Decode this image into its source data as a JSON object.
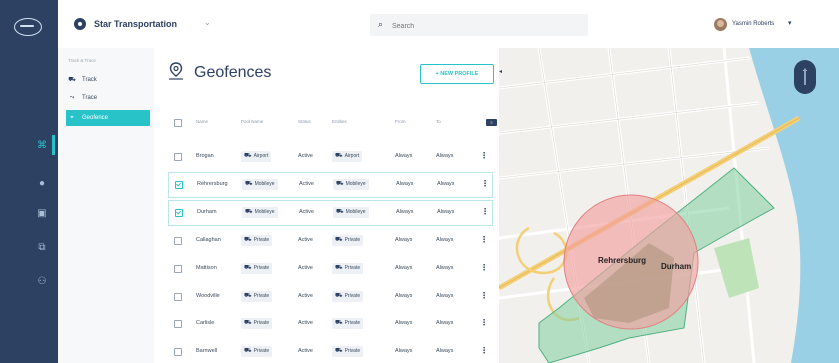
{
  "header": {
    "org_name": "Star Transportation",
    "search_placeholder": "Search",
    "user_name": "Yasmin Roberts"
  },
  "sidebar": {
    "section_label": "Track & Trace",
    "items": [
      {
        "label": "Track",
        "icon": "truck-icon",
        "active": false
      },
      {
        "label": "Trace",
        "icon": "route-icon",
        "active": false
      },
      {
        "label": "Geofence",
        "icon": "pin-icon",
        "active": true
      }
    ]
  },
  "main": {
    "title": "Geofences",
    "new_button": "+ NEW PROFILE",
    "columns": [
      "Name",
      "Pool Name",
      "Status",
      "Entities",
      "From",
      "To"
    ],
    "columns_badge": "≡",
    "rows": [
      {
        "name": "Brogan",
        "pool": "Airport",
        "status": "Active",
        "entities": "Airport",
        "from": "Always",
        "to": "Always",
        "checked": false
      },
      {
        "name": "Rehrersburg",
        "pool": "Mobileye",
        "status": "Active",
        "entities": "Mobileye",
        "from": "Always",
        "to": "Always",
        "checked": true
      },
      {
        "name": "Durham",
        "pool": "Mobileye",
        "status": "Active",
        "entities": "Mobileye",
        "from": "Always",
        "to": "Always",
        "checked": true
      },
      {
        "name": "Callaghan",
        "pool": "Private",
        "status": "Active",
        "entities": "Private",
        "from": "Always",
        "to": "Always",
        "checked": false
      },
      {
        "name": "Mattison",
        "pool": "Private",
        "status": "Active",
        "entities": "Private",
        "from": "Always",
        "to": "Always",
        "checked": false
      },
      {
        "name": "Woodville",
        "pool": "Private",
        "status": "Active",
        "entities": "Private",
        "from": "Always",
        "to": "Always",
        "checked": false
      },
      {
        "name": "Carlisle",
        "pool": "Private",
        "status": "Active",
        "entities": "Private",
        "from": "Always",
        "to": "Always",
        "checked": false
      },
      {
        "name": "Barnwell",
        "pool": "Private",
        "status": "Active",
        "entities": "Private",
        "from": "Always",
        "to": "Always",
        "checked": false
      }
    ]
  },
  "map": {
    "labels": [
      "Rehrersburg",
      "Durham"
    ],
    "colors": {
      "geofence_circle": "#f2a0a0",
      "geofence_polygon": "#7fd0a0",
      "water": "#9ad0e6"
    }
  },
  "rail": {
    "icons": [
      "geofence-icon",
      "globe-icon",
      "camera-icon",
      "share-icon",
      "users-icon"
    ]
  },
  "colors": {
    "accent": "#27c3c9",
    "navy": "#2d4163"
  }
}
